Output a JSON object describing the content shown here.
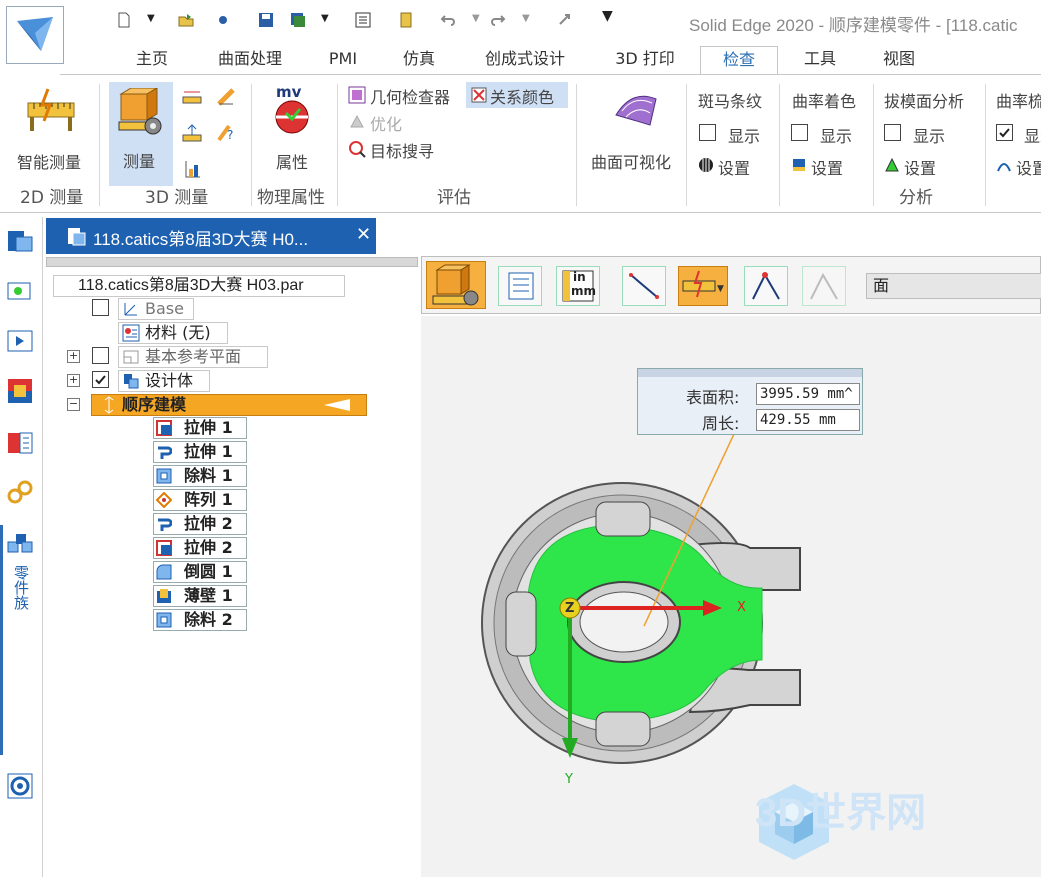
{
  "window": {
    "title": "Solid Edge 2020 - 顺序建模零件 - [118.catic"
  },
  "ribbon_tabs": [
    {
      "label": "主页"
    },
    {
      "label": "曲面处理"
    },
    {
      "label": "PMI"
    },
    {
      "label": "仿真"
    },
    {
      "label": "创成式设计"
    },
    {
      "label": "3D 打印"
    },
    {
      "label": "检查"
    },
    {
      "label": "工具"
    },
    {
      "label": "视图"
    }
  ],
  "active_tab": "检查",
  "ribbon": {
    "smart_measure": "智能测量",
    "group_2d": "2D 测量",
    "measure": "测量",
    "group_3d": "3D 测量",
    "properties": "属性",
    "properties_badge": "mv",
    "group_physical": "物理属性",
    "geometry_inspector": "几何检查器",
    "relation_colors": "关系颜色",
    "optimize": "优化",
    "target_search": "目标搜寻",
    "group_evaluate": "评估",
    "surface_visualization": "曲面可视化",
    "zebra": "斑马条纹",
    "curvature_shading": "曲率着色",
    "draft_analysis": "拔模面分析",
    "curvature_comb": "曲率梳",
    "show": "显示",
    "settings": "设置",
    "group_analysis": "分析"
  },
  "side_panel": {
    "vertical_label": "零件族"
  },
  "document_tab": {
    "title": "118.catics第8届3D大赛 H0...",
    "close": "✕"
  },
  "tree": {
    "root": "118.catics第8届3D大赛 H03.par",
    "base": "Base",
    "material": "材料 (无)",
    "ref_planes": "基本参考平面",
    "design_body": "设计体",
    "ordered_modeling": "顺序建模",
    "features": [
      {
        "label": "拉伸 1",
        "icon": "extrude-icon"
      },
      {
        "label": "拉伸 1",
        "icon": "revolve-icon"
      },
      {
        "label": "除料 1",
        "icon": "cutout-icon"
      },
      {
        "label": "阵列 1",
        "icon": "pattern-icon"
      },
      {
        "label": "拉伸 2",
        "icon": "revolve-icon"
      },
      {
        "label": "拉伸 2",
        "icon": "extrude-icon"
      },
      {
        "label": "倒圆 1",
        "icon": "round-icon"
      },
      {
        "label": "薄壁 1",
        "icon": "thinwall-icon"
      },
      {
        "label": "除料 2",
        "icon": "cutout-icon"
      }
    ]
  },
  "viewport_toolbar": {
    "select_filter": "面",
    "units_icon_text_top": "in",
    "units_icon_text_bottom": "mm"
  },
  "measure": {
    "area_label": "表面积:",
    "area_value": "3995.59 mm^",
    "perimeter_label": "周长:",
    "perimeter_value": "429.55 mm"
  },
  "axes": {
    "x": "X",
    "y": "Y",
    "z": "Z"
  },
  "watermark": "3D世界网",
  "colors": {
    "accent": "#1e61b0",
    "highlight_face": "#2ee64a",
    "ordered_bar": "#f5a623"
  }
}
